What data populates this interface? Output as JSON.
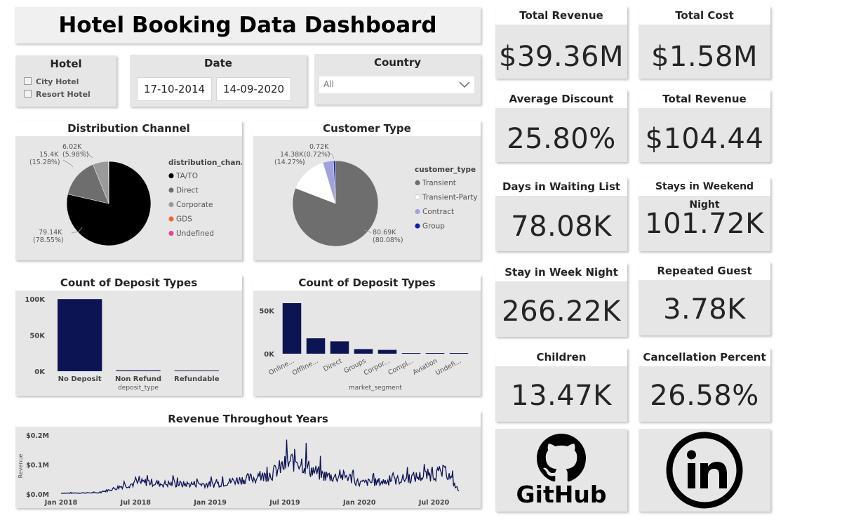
{
  "header": {
    "title": "Hotel Booking Data Dashboard"
  },
  "slicers": {
    "hotel": {
      "title": "Hotel",
      "options": [
        "City Hotel",
        "Resort Hotel"
      ]
    },
    "date": {
      "title": "Date",
      "start": "17-10-2014",
      "end": "14-09-2020"
    },
    "country": {
      "title": "Country",
      "value": "All"
    }
  },
  "kpis": [
    {
      "title": "Total Revenue",
      "value": "$39.36M"
    },
    {
      "title": "Total Cost",
      "value": "$1.58M"
    },
    {
      "title": "Average Discount",
      "value": "25.80%"
    },
    {
      "title": "Total Revenue",
      "value": "$104.44"
    },
    {
      "title": "Days in Waiting List",
      "value": "78.08K"
    },
    {
      "title": "Stays in Weekend Night",
      "value": "101.72K"
    },
    {
      "title": "Stay in Week Night",
      "value": "266.22K"
    },
    {
      "title": "Repeated Guest",
      "value": "3.78K"
    },
    {
      "title": "Children",
      "value": "13.47K"
    },
    {
      "title": "Cancellation Percent",
      "value": "26.58%"
    }
  ],
  "links": {
    "github_label": "GitHub",
    "github_icon": "github-icon",
    "linkedin_icon": "linkedin-icon"
  },
  "chart_data": [
    {
      "type": "pie",
      "title": "Distribution Channel",
      "legend_title": "distribution_chan...",
      "legend_position": "right",
      "slices": [
        {
          "name": "TA/TO",
          "value": 79140,
          "label": "79.14K",
          "pct": "(78.55%)",
          "color": "#000000"
        },
        {
          "name": "Direct",
          "value": 15400,
          "label": "15.4K",
          "pct": "(15.28%)",
          "color": "#6e6e6e"
        },
        {
          "name": "Corporate",
          "value": 6020,
          "label": "6.02K",
          "pct": "(5.98%)",
          "color": "#9a9a9a"
        },
        {
          "name": "GDS",
          "value": 150,
          "label": "",
          "pct": "",
          "color": "#e8692d"
        },
        {
          "name": "Undefined",
          "value": 5,
          "label": "",
          "pct": "",
          "color": "#e0479e"
        }
      ]
    },
    {
      "type": "pie",
      "title": "Customer Type",
      "legend_title": "customer_type",
      "legend_position": "right",
      "slices": [
        {
          "name": "Transient",
          "value": 80690,
          "label": "80.69K",
          "pct": "(80.08%)",
          "color": "#6e6e6e"
        },
        {
          "name": "Transient-Party",
          "value": 14380,
          "label": "14.38K",
          "pct": "(14.27%)",
          "color": "#ffffff"
        },
        {
          "name": "Contract",
          "value": 4000,
          "label": "",
          "pct": "",
          "color": "#9fa3dd"
        },
        {
          "name": "Group",
          "value": 720,
          "label": "0.72K",
          "pct": "(0.72%)",
          "color": "#12239e"
        }
      ]
    },
    {
      "type": "bar",
      "title": "Count of Deposit Types",
      "xlabel": "deposit_type",
      "ylabel": "",
      "categories": [
        "No Deposit",
        "Non Refund",
        "Refundable"
      ],
      "values": [
        99800,
        1200,
        200
      ],
      "yticks": [
        "0K",
        "50K",
        "100K"
      ],
      "ylim": [
        0,
        100000
      ],
      "color": "#0d1454"
    },
    {
      "type": "bar",
      "title": "Count of Deposit Types",
      "xlabel": "market_segment",
      "ylabel": "",
      "categories": [
        "Online...",
        "Offline...",
        "Direct",
        "Groups",
        "Corpor...",
        "Compl...",
        "Aviation",
        "Undefi..."
      ],
      "values": [
        58500,
        17800,
        14300,
        5300,
        4400,
        700,
        220,
        2
      ],
      "yticks": [
        "0K",
        "50K"
      ],
      "ylim": [
        0,
        65000
      ],
      "color": "#0d1454"
    },
    {
      "type": "line",
      "title": "Revenue Throughout Years",
      "xlabel": "",
      "ylabel": "Revenue",
      "yticks": [
        "$0.0M",
        "$0.1M",
        "$0.2M"
      ],
      "ylim": [
        0,
        0.2
      ],
      "xticks": [
        "Jan 2018",
        "Jul 2018",
        "Jan 2019",
        "Jul 2019",
        "Jan 2020",
        "Jul 2020"
      ],
      "color": "#0d1454",
      "series": [
        {
          "x": [
            "2018-01",
            "2018-02",
            "2018-03",
            "2018-04",
            "2018-05",
            "2018-06",
            "2018-07",
            "2018-08",
            "2018-09",
            "2018-10",
            "2018-11",
            "2018-12",
            "2019-01",
            "2019-02",
            "2019-03",
            "2019-04",
            "2019-05",
            "2019-06",
            "2019-07",
            "2019-08",
            "2019-09",
            "2019-10",
            "2019-11",
            "2019-12",
            "2020-01",
            "2020-02",
            "2020-03",
            "2020-04",
            "2020-05",
            "2020-06",
            "2020-07",
            "2020-08",
            "2020-09"
          ],
          "y": [
            0.003,
            0.003,
            0.004,
            0.004,
            0.015,
            0.028,
            0.036,
            0.041,
            0.035,
            0.034,
            0.033,
            0.035,
            0.032,
            0.037,
            0.046,
            0.052,
            0.055,
            0.07,
            0.098,
            0.118,
            0.085,
            0.064,
            0.058,
            0.06,
            0.037,
            0.04,
            0.042,
            0.047,
            0.055,
            0.06,
            0.068,
            0.074,
            0.01
          ]
        }
      ]
    }
  ]
}
